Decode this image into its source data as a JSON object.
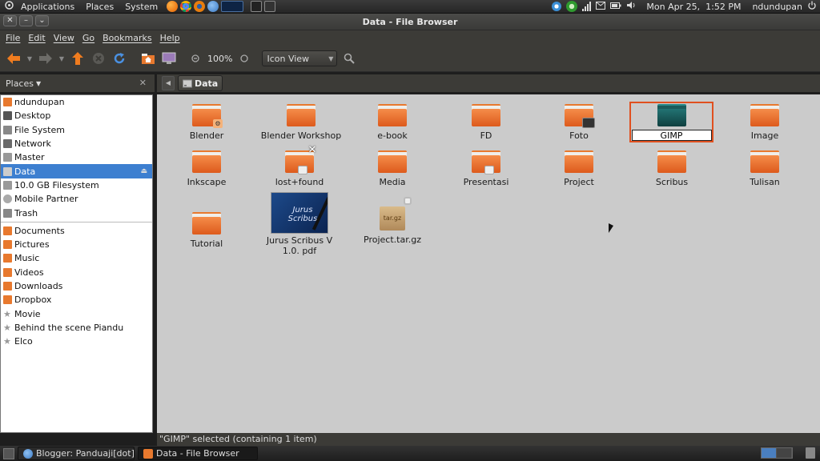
{
  "top_panel": {
    "menus": [
      "Applications",
      "Places",
      "System"
    ],
    "launchers": [
      {
        "icon": "firefox-icon",
        "color": "#e66000"
      },
      {
        "icon": "chrome-icon",
        "color": "#4a8af4"
      },
      {
        "icon": "blender-icon",
        "color": "#e87d0d"
      },
      {
        "icon": "thunderbird-icon",
        "color": "#3a79c4"
      },
      {
        "icon": "system-monitor-icon",
        "color": "#1b3d6b"
      },
      {
        "icon": "terminal-icon",
        "color": "#2b2b2b"
      },
      {
        "icon": "shell-icon",
        "color": "#444444"
      }
    ],
    "clock": "Mon Apr 25,  1:52 PM",
    "user": "ndundupan"
  },
  "window": {
    "title": "Data - File Browser"
  },
  "menubar": [
    "File",
    "Edit",
    "View",
    "Go",
    "Bookmarks",
    "Help"
  ],
  "toolbar": {
    "zoom": "100%",
    "view_mode": "Icon View"
  },
  "sidebar": {
    "header": "Places",
    "places": [
      {
        "label": "ndundupan",
        "icon": "home-folder-icon",
        "color": "#e8792e"
      },
      {
        "label": "Desktop",
        "icon": "desktop-icon",
        "color": "#555555"
      },
      {
        "label": "File System",
        "icon": "harddisk-icon",
        "color": "#888888"
      },
      {
        "label": "Network",
        "icon": "network-icon",
        "color": "#6a6a6a"
      },
      {
        "label": "Master",
        "icon": "drive-icon",
        "color": "#999999"
      },
      {
        "label": "Data",
        "icon": "drive-icon",
        "color": "#cccccc",
        "selected": true
      },
      {
        "label": "10.0 GB Filesystem",
        "icon": "drive-icon",
        "color": "#999999"
      },
      {
        "label": "Mobile Partner",
        "icon": "cdrom-icon",
        "color": "#aaaaaa"
      },
      {
        "label": "Trash",
        "icon": "trash-icon",
        "color": "#888888"
      }
    ],
    "bookmarks": [
      {
        "label": "Documents",
        "icon": "folder-icon",
        "color": "#e8792e"
      },
      {
        "label": "Pictures",
        "icon": "folder-icon",
        "color": "#e8792e"
      },
      {
        "label": "Music",
        "icon": "folder-icon",
        "color": "#e8792e"
      },
      {
        "label": "Videos",
        "icon": "folder-icon",
        "color": "#e8792e"
      },
      {
        "label": "Downloads",
        "icon": "folder-icon",
        "color": "#e8792e"
      },
      {
        "label": "Dropbox",
        "icon": "folder-icon",
        "color": "#e8792e"
      },
      {
        "label": "Movie",
        "icon": "bookmark-star-icon",
        "color": "#999999"
      },
      {
        "label": "Behind the scene Piandu",
        "icon": "bookmark-star-icon",
        "color": "#999999"
      },
      {
        "label": "Elco",
        "icon": "bookmark-star-icon",
        "color": "#999999"
      }
    ]
  },
  "pathbar": {
    "current": "Data"
  },
  "files": {
    "blender": "Blender",
    "blender_workshop": "Blender Workshop",
    "ebook": "e-book",
    "fd": "FD",
    "foto": "Foto",
    "gimp": "GIMP",
    "image": "Image",
    "inkscape": "Inkscape",
    "lost_found": "lost+found",
    "media": "Media",
    "presentasi": "Presentasi",
    "project": "Project",
    "scribus": "Scribus",
    "tulisan": "Tulisan",
    "tutorial": "Tutorial",
    "pdf": "Jurus Scribus V 1.0. pdf",
    "pdf_thumb_text": "Jurus Scribus",
    "archive": "Project.tar.gz",
    "archive_ext": "tar.gz"
  },
  "status": "\"GIMP\" selected (containing 1 item)",
  "taskbar": [
    {
      "label": "Blogger: Panduaji[dot]...",
      "icon": "browser-icon",
      "active": false
    },
    {
      "label": "Data - File Browser",
      "icon": "folder-icon",
      "active": true
    }
  ]
}
